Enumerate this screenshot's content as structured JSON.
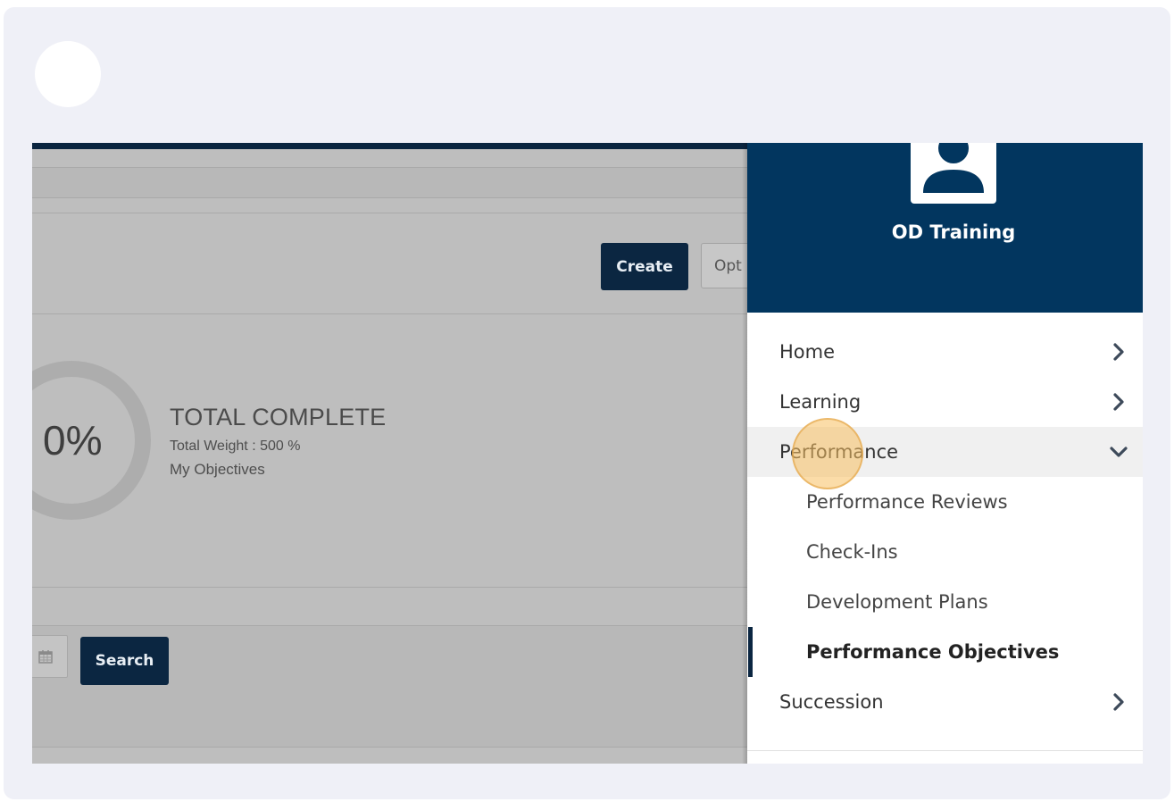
{
  "toolbar": {
    "create_label": "Create",
    "options_label": "Opt"
  },
  "summary": {
    "percent": "0%",
    "title": "TOTAL COMPLETE",
    "weight": "Total Weight : 500 %",
    "subtitle": "My Objectives"
  },
  "filters": {
    "search_label": "Search",
    "calendar_icon": "calendar-icon"
  },
  "user": {
    "name": "OD Training",
    "avatar_icon": "user-icon"
  },
  "menu": {
    "items": [
      {
        "label": "Home",
        "icon": "chevron-right-icon"
      },
      {
        "label": "Learning",
        "icon": "chevron-right-icon"
      },
      {
        "label": "Performance",
        "icon": "chevron-down-icon",
        "expanded": true
      },
      {
        "label": "Succession",
        "icon": "chevron-right-icon"
      }
    ],
    "performance_children": [
      {
        "label": "Performance Reviews"
      },
      {
        "label": "Check-Ins"
      },
      {
        "label": "Development Plans"
      },
      {
        "label": "Performance Objectives",
        "current": true
      }
    ]
  },
  "colors": {
    "navy": "#0b2641",
    "header_blue": "#02365f",
    "frame_bg": "#eff0f7",
    "click_highlight": "#f8c060"
  }
}
